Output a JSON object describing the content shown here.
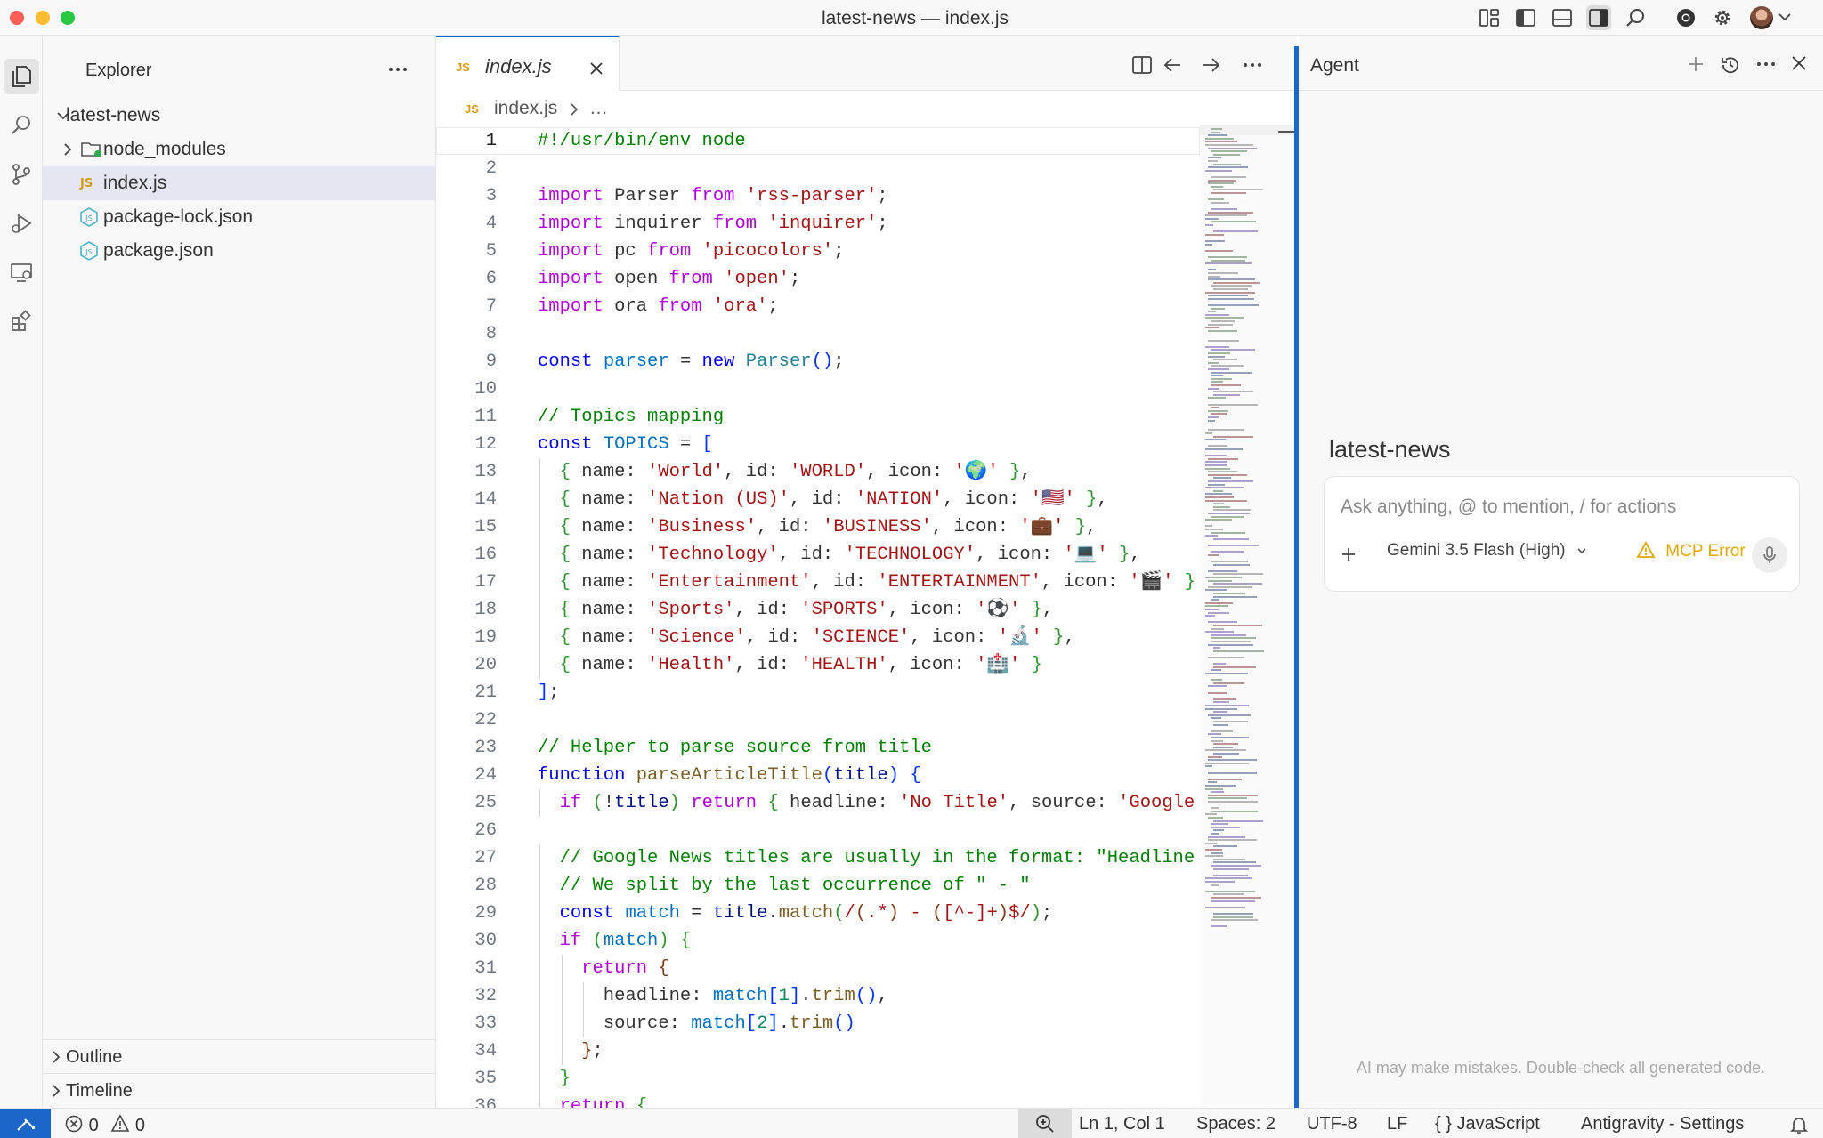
{
  "window": {
    "title": "latest-news — index.js"
  },
  "titlebar_icons": [
    "layout-icon",
    "toggle-primary-sidebar-icon",
    "toggle-panel-icon",
    "toggle-secondary-sidebar-icon",
    "search-icon",
    "chrome-icon",
    "gear-icon",
    "avatar"
  ],
  "activity_bar": [
    "explorer-icon",
    "search-icon",
    "source-control-icon",
    "run-debug-icon",
    "remote-explorer-icon",
    "extensions-icon"
  ],
  "explorer": {
    "title": "Explorer",
    "root": "latest-news",
    "items": [
      {
        "label": "node_modules",
        "type": "folder"
      },
      {
        "label": "index.js",
        "type": "js",
        "badge": "JS"
      },
      {
        "label": "package-lock.json",
        "type": "json"
      },
      {
        "label": "package.json",
        "type": "json"
      }
    ],
    "outline": "Outline",
    "timeline": "Timeline"
  },
  "editor": {
    "tab": {
      "badge": "JS",
      "label": "index.js"
    },
    "breadcrumb": {
      "badge": "JS",
      "file": "index.js",
      "rest": "…"
    },
    "lines": [
      [
        [
          "c",
          "#!/usr/bin/env node"
        ]
      ],
      [],
      [
        [
          "kc",
          "import"
        ],
        [
          "t",
          " Parser "
        ],
        [
          "kc",
          "from"
        ],
        [
          "t",
          " "
        ],
        [
          "s",
          "'rss-parser'"
        ],
        [
          "t",
          ";"
        ]
      ],
      [
        [
          "kc",
          "import"
        ],
        [
          "t",
          " inquirer "
        ],
        [
          "kc",
          "from"
        ],
        [
          "t",
          " "
        ],
        [
          "s",
          "'inquirer'"
        ],
        [
          "t",
          ";"
        ]
      ],
      [
        [
          "kc",
          "import"
        ],
        [
          "t",
          " pc "
        ],
        [
          "kc",
          "from"
        ],
        [
          "t",
          " "
        ],
        [
          "s",
          "'picocolors'"
        ],
        [
          "t",
          ";"
        ]
      ],
      [
        [
          "kc",
          "import"
        ],
        [
          "t",
          " open "
        ],
        [
          "kc",
          "from"
        ],
        [
          "t",
          " "
        ],
        [
          "s",
          "'open'"
        ],
        [
          "t",
          ";"
        ]
      ],
      [
        [
          "kc",
          "import"
        ],
        [
          "t",
          " ora "
        ],
        [
          "kc",
          "from"
        ],
        [
          "t",
          " "
        ],
        [
          "s",
          "'ora'"
        ],
        [
          "t",
          ";"
        ]
      ],
      [],
      [
        [
          "k",
          "const"
        ],
        [
          "t",
          " "
        ],
        [
          "cn",
          "parser"
        ],
        [
          "t",
          " = "
        ],
        [
          "k",
          "new"
        ],
        [
          "t",
          " "
        ],
        [
          "ty",
          "Parser"
        ],
        [
          "p1",
          "()"
        ],
        [
          "t",
          ";"
        ]
      ],
      [],
      [
        [
          "c",
          "// Topics mapping"
        ]
      ],
      [
        [
          "k",
          "const"
        ],
        [
          "t",
          " "
        ],
        [
          "cn",
          "TOPICS"
        ],
        [
          "t",
          " = "
        ],
        [
          "p1",
          "["
        ]
      ],
      [
        [
          "t",
          "  "
        ],
        [
          "p2",
          "{"
        ],
        [
          "t",
          " name: "
        ],
        [
          "s",
          "'World'"
        ],
        [
          "t",
          ", id: "
        ],
        [
          "s",
          "'WORLD'"
        ],
        [
          "t",
          ", icon: "
        ],
        [
          "s",
          "'🌍'"
        ],
        [
          "t",
          " "
        ],
        [
          "p2",
          "}"
        ],
        [
          "t",
          ","
        ]
      ],
      [
        [
          "t",
          "  "
        ],
        [
          "p2",
          "{"
        ],
        [
          "t",
          " name: "
        ],
        [
          "s",
          "'Nation (US)'"
        ],
        [
          "t",
          ", id: "
        ],
        [
          "s",
          "'NATION'"
        ],
        [
          "t",
          ", icon: "
        ],
        [
          "s",
          "'🇺🇸'"
        ],
        [
          "t",
          " "
        ],
        [
          "p2",
          "}"
        ],
        [
          "t",
          ","
        ]
      ],
      [
        [
          "t",
          "  "
        ],
        [
          "p2",
          "{"
        ],
        [
          "t",
          " name: "
        ],
        [
          "s",
          "'Business'"
        ],
        [
          "t",
          ", id: "
        ],
        [
          "s",
          "'BUSINESS'"
        ],
        [
          "t",
          ", icon: "
        ],
        [
          "s",
          "'💼'"
        ],
        [
          "t",
          " "
        ],
        [
          "p2",
          "}"
        ],
        [
          "t",
          ","
        ]
      ],
      [
        [
          "t",
          "  "
        ],
        [
          "p2",
          "{"
        ],
        [
          "t",
          " name: "
        ],
        [
          "s",
          "'Technology'"
        ],
        [
          "t",
          ", id: "
        ],
        [
          "s",
          "'TECHNOLOGY'"
        ],
        [
          "t",
          ", icon: "
        ],
        [
          "s",
          "'💻'"
        ],
        [
          "t",
          " "
        ],
        [
          "p2",
          "}"
        ],
        [
          "t",
          ","
        ]
      ],
      [
        [
          "t",
          "  "
        ],
        [
          "p2",
          "{"
        ],
        [
          "t",
          " name: "
        ],
        [
          "s",
          "'Entertainment'"
        ],
        [
          "t",
          ", id: "
        ],
        [
          "s",
          "'ENTERTAINMENT'"
        ],
        [
          "t",
          ", icon: "
        ],
        [
          "s",
          "'🎬'"
        ],
        [
          "t",
          " "
        ],
        [
          "p2",
          "}"
        ]
      ],
      [
        [
          "t",
          "  "
        ],
        [
          "p2",
          "{"
        ],
        [
          "t",
          " name: "
        ],
        [
          "s",
          "'Sports'"
        ],
        [
          "t",
          ", id: "
        ],
        [
          "s",
          "'SPORTS'"
        ],
        [
          "t",
          ", icon: "
        ],
        [
          "s",
          "'⚽'"
        ],
        [
          "t",
          " "
        ],
        [
          "p2",
          "}"
        ],
        [
          "t",
          ","
        ]
      ],
      [
        [
          "t",
          "  "
        ],
        [
          "p2",
          "{"
        ],
        [
          "t",
          " name: "
        ],
        [
          "s",
          "'Science'"
        ],
        [
          "t",
          ", id: "
        ],
        [
          "s",
          "'SCIENCE'"
        ],
        [
          "t",
          ", icon: "
        ],
        [
          "s",
          "'🔬'"
        ],
        [
          "t",
          " "
        ],
        [
          "p2",
          "}"
        ],
        [
          "t",
          ","
        ]
      ],
      [
        [
          "t",
          "  "
        ],
        [
          "p2",
          "{"
        ],
        [
          "t",
          " name: "
        ],
        [
          "s",
          "'Health'"
        ],
        [
          "t",
          ", id: "
        ],
        [
          "s",
          "'HEALTH'"
        ],
        [
          "t",
          ", icon: "
        ],
        [
          "s",
          "'🏥'"
        ],
        [
          "t",
          " "
        ],
        [
          "p2",
          "}"
        ]
      ],
      [
        [
          "p1",
          "]"
        ],
        [
          "t",
          ";"
        ]
      ],
      [],
      [
        [
          "c",
          "// Helper to parse source from title"
        ]
      ],
      [
        [
          "k",
          "function"
        ],
        [
          "t",
          " "
        ],
        [
          "fn",
          "parseArticleTitle"
        ],
        [
          "p1",
          "("
        ],
        [
          "v",
          "title"
        ],
        [
          "p1",
          ")"
        ],
        [
          "t",
          " "
        ],
        [
          "p1",
          "{"
        ]
      ],
      [
        [
          "t",
          "  "
        ],
        [
          "kc",
          "if"
        ],
        [
          "t",
          " "
        ],
        [
          "p2",
          "("
        ],
        [
          "t",
          "!"
        ],
        [
          "v",
          "title"
        ],
        [
          "p2",
          ")"
        ],
        [
          "t",
          " "
        ],
        [
          "kc",
          "return"
        ],
        [
          "t",
          " "
        ],
        [
          "p2",
          "{"
        ],
        [
          "t",
          " headline: "
        ],
        [
          "s",
          "'No Title'"
        ],
        [
          "t",
          ", source: "
        ],
        [
          "s",
          "'Google"
        ]
      ],
      [],
      [
        [
          "t",
          "  "
        ],
        [
          "c",
          "// Google News titles are usually in the format: \"Headline"
        ]
      ],
      [
        [
          "t",
          "  "
        ],
        [
          "c",
          "// We split by the last occurrence of \" - \""
        ]
      ],
      [
        [
          "t",
          "  "
        ],
        [
          "k",
          "const"
        ],
        [
          "t",
          " "
        ],
        [
          "cn",
          "match"
        ],
        [
          "t",
          " = "
        ],
        [
          "v",
          "title"
        ],
        [
          "t",
          "."
        ],
        [
          "fn",
          "match"
        ],
        [
          "p2",
          "("
        ],
        [
          "s",
          "/"
        ],
        [
          "p3",
          "("
        ],
        [
          "s",
          ".*"
        ],
        [
          "p3",
          ")"
        ],
        [
          "s",
          " - "
        ],
        [
          "p3",
          "("
        ],
        [
          "s",
          "[^-]+"
        ],
        [
          "p3",
          ")"
        ],
        [
          "s",
          "$/"
        ],
        [
          "p2",
          ")"
        ],
        [
          "t",
          ";"
        ]
      ],
      [
        [
          "t",
          "  "
        ],
        [
          "kc",
          "if"
        ],
        [
          "t",
          " "
        ],
        [
          "p2",
          "("
        ],
        [
          "cn",
          "match"
        ],
        [
          "p2",
          ")"
        ],
        [
          "t",
          " "
        ],
        [
          "p2",
          "{"
        ]
      ],
      [
        [
          "t",
          "    "
        ],
        [
          "kc",
          "return"
        ],
        [
          "t",
          " "
        ],
        [
          "p3",
          "{"
        ]
      ],
      [
        [
          "t",
          "      headline: "
        ],
        [
          "cn",
          "match"
        ],
        [
          "p1",
          "["
        ],
        [
          "n",
          "1"
        ],
        [
          "p1",
          "]"
        ],
        [
          "t",
          "."
        ],
        [
          "fn",
          "trim"
        ],
        [
          "p1",
          "()"
        ],
        [
          "t",
          ","
        ]
      ],
      [
        [
          "t",
          "      source: "
        ],
        [
          "cn",
          "match"
        ],
        [
          "p1",
          "["
        ],
        [
          "n",
          "2"
        ],
        [
          "p1",
          "]"
        ],
        [
          "t",
          "."
        ],
        [
          "fn",
          "trim"
        ],
        [
          "p1",
          "()"
        ]
      ],
      [
        [
          "t",
          "    "
        ],
        [
          "p3",
          "}"
        ],
        [
          "t",
          ";"
        ]
      ],
      [
        [
          "t",
          "  "
        ],
        [
          "p2",
          "}"
        ]
      ],
      [
        [
          "t",
          "  "
        ],
        [
          "kc",
          "return"
        ],
        [
          "t",
          " "
        ],
        [
          "p2",
          "{"
        ]
      ]
    ]
  },
  "agent": {
    "title": "Agent",
    "workspace": "latest-news",
    "placeholder": "Ask anything, @ to mention, / for actions",
    "model": "Gemini 3.5 Flash (High)",
    "mcp_error": "MCP Error",
    "disclaimer": "AI may make mistakes. Double-check all generated code."
  },
  "status": {
    "errors": "0",
    "warnings": "0",
    "position": "Ln 1, Col 1",
    "spaces": "Spaces: 2",
    "encoding": "UTF-8",
    "eol": "LF",
    "language": "JavaScript",
    "settings": "Antigravity - Settings"
  },
  "colors": {
    "accent": "#1a66c9",
    "selection": "#e4e6f1",
    "warning": "#e0a800",
    "js_badge": "#d89b15",
    "json_icon": "#4fb3c7"
  }
}
